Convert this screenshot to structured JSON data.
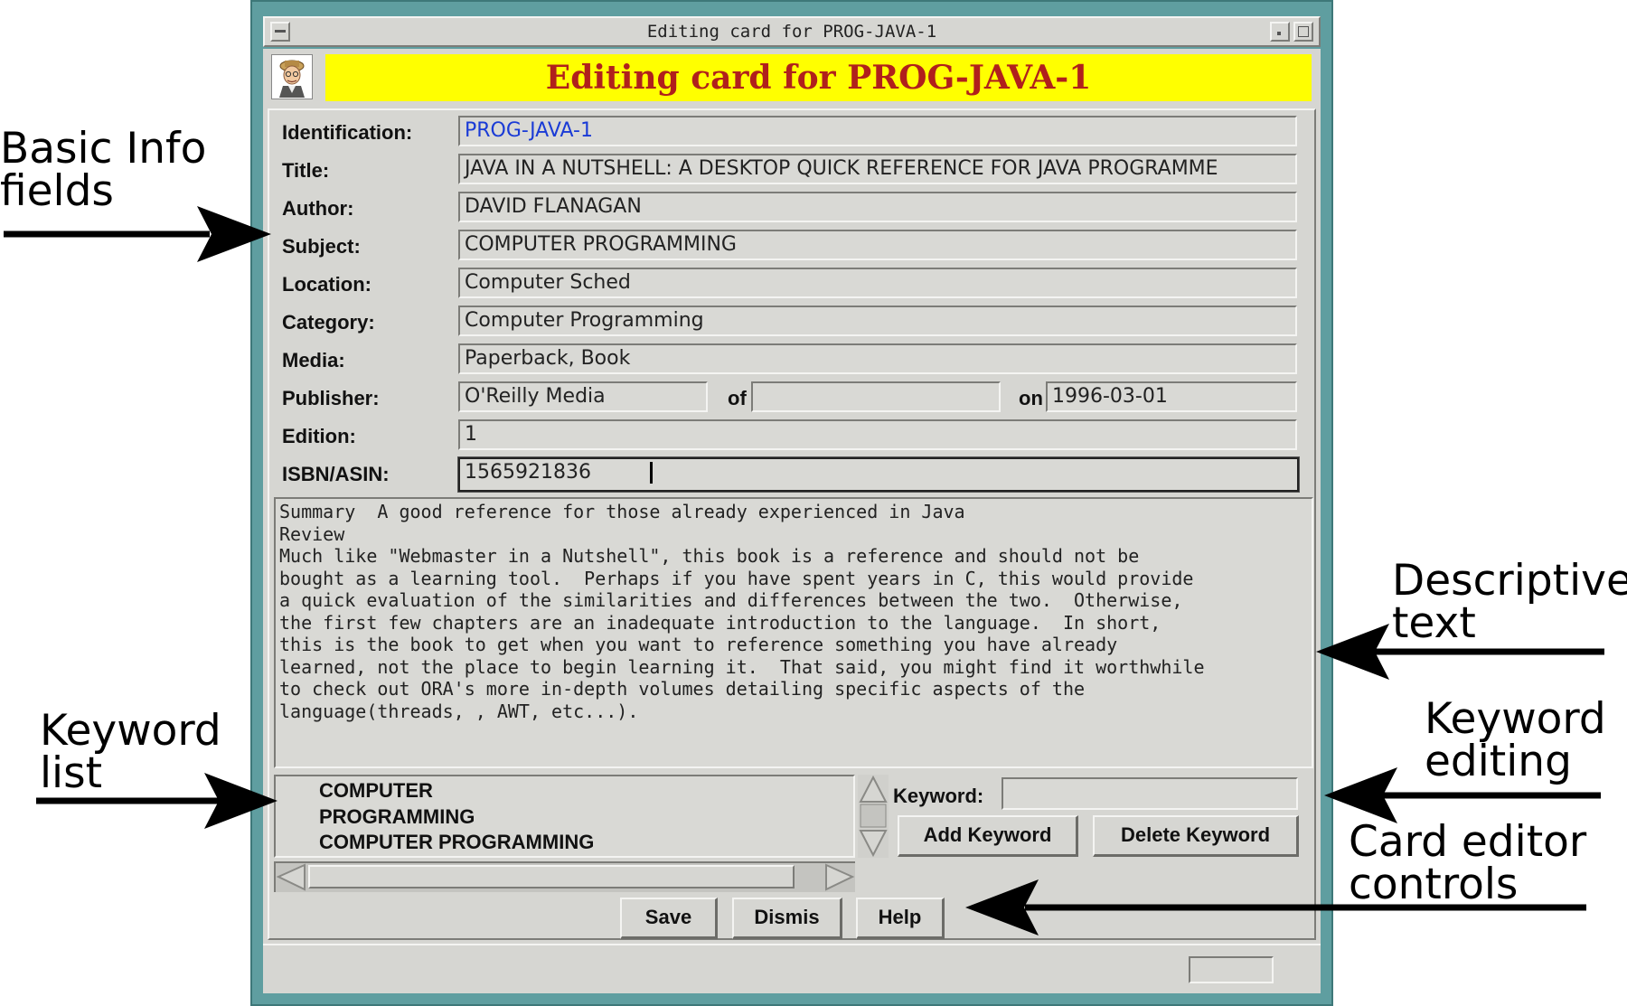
{
  "window": {
    "title": "Editing card for PROG-JAVA-1",
    "banner": "Editing card for PROG-JAVA-1"
  },
  "form": {
    "identification": {
      "label": "Identification:",
      "value": "PROG-JAVA-1"
    },
    "title": {
      "label": "Title:",
      "value": "JAVA IN A NUTSHELL: A DESKTOP QUICK REFERENCE FOR JAVA PROGRAMME"
    },
    "author": {
      "label": "Author:",
      "value": "DAVID FLANAGAN"
    },
    "subject": {
      "label": "Subject:",
      "value": "COMPUTER PROGRAMMING"
    },
    "location": {
      "label": "Location:",
      "value": "Computer Sched"
    },
    "category": {
      "label": "Category:",
      "value": "Computer Programming"
    },
    "media": {
      "label": "Media:",
      "value": "Paperback, Book"
    },
    "publisher": {
      "label": "Publisher:",
      "value": "O'Reilly Media",
      "of_label": "of",
      "of_value": "",
      "on_label": "on",
      "on_value": "1996-03-01"
    },
    "edition": {
      "label": "Edition:",
      "value": "1"
    },
    "isbn": {
      "label": "ISBN/ASIN:",
      "value": "1565921836"
    }
  },
  "description": "Summary  A good reference for those already experienced in Java\nReview\nMuch like \"Webmaster in a Nutshell\", this book is a reference and should not be\nbought as a learning tool.  Perhaps if you have spent years in C, this would provide\na quick evaluation of the similarities and differences between the two.  Otherwise,\nthe first few chapters are an inadequate introduction to the language.  In short,\nthis is the book to get when you want to reference something you have already\nlearned, not the place to begin learning it.  That said, you might find it worthwhile\nto check out ORA's more in-depth volumes detailing specific aspects of the\nlanguage(threads, , AWT, etc...).",
  "keywords": {
    "items": [
      "COMPUTER",
      "PROGRAMMING",
      "COMPUTER PROGRAMMING"
    ],
    "input_label": "Keyword:",
    "input_value": "",
    "add_label": "Add Keyword",
    "delete_label": "Delete Keyword"
  },
  "controls": {
    "save": "Save",
    "dismiss": "Dismis",
    "help": "Help"
  },
  "callouts": {
    "basic_info": [
      "Basic Info",
      "fields"
    ],
    "keyword_list": [
      "Keyword",
      "list"
    ],
    "descriptive": [
      "Descriptive",
      "text"
    ],
    "keyword_editing": [
      "Keyword",
      "editing"
    ],
    "controls": [
      "Card editor",
      "controls"
    ]
  },
  "colors": {
    "window_frame": "#5f9ea0",
    "banner_bg": "#ffff00",
    "banner_text": "#b0201c",
    "id_text": "#1a3bd6",
    "panel_bg": "#d6d6d2"
  }
}
